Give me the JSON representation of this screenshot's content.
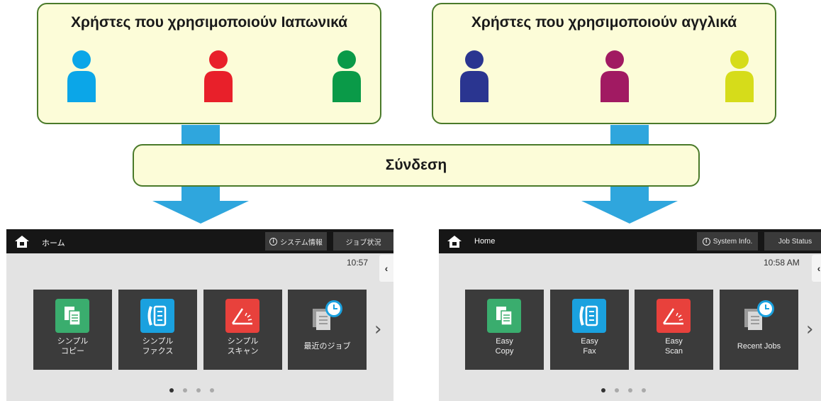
{
  "groups": {
    "left_title": "Χρήστες που χρησιμοποιούν Ιαπωνικά",
    "right_title": "Χρήστες που χρησιμοποιούν αγγλικά",
    "left_colors": [
      "#0ba6e8",
      "#e8202a",
      "#0a9a48"
    ],
    "right_colors": [
      "#2a3590",
      "#a11a62",
      "#d6dc1a"
    ]
  },
  "login_label": "Σύνδεση",
  "arrow_color": "#2fa6dd",
  "screen_jp": {
    "home_label": "ホーム",
    "system_info": "システム情報",
    "job_status": "ジョブ状況",
    "time": "10:57",
    "tiles": [
      {
        "label": "シンプル\nコピー",
        "icon": "copy-icon"
      },
      {
        "label": "シンプル\nファクス",
        "icon": "fax-icon"
      },
      {
        "label": "シンプル\nスキャン",
        "icon": "scan-icon"
      },
      {
        "label": "最近のジョブ",
        "icon": "recent-jobs-icon"
      }
    ]
  },
  "screen_en": {
    "home_label": "Home",
    "system_info": "System Info.",
    "job_status": "Job Status",
    "time": "10:58 AM",
    "tiles": [
      {
        "label": "Easy\nCopy",
        "icon": "copy-icon"
      },
      {
        "label": "Easy\nFax",
        "icon": "fax-icon"
      },
      {
        "label": "Easy\nScan",
        "icon": "scan-icon"
      },
      {
        "label": "Recent Jobs",
        "icon": "recent-jobs-icon"
      }
    ]
  }
}
